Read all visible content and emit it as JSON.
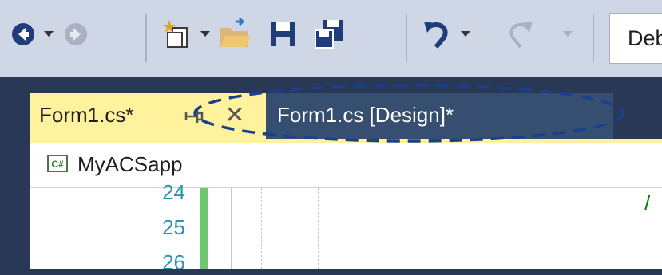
{
  "toolbar": {
    "icons": [
      "back-arrow-icon",
      "forward-arrow-icon",
      "new-project-icon",
      "open-file-icon",
      "save-icon",
      "save-all-icon",
      "undo-icon",
      "redo-icon",
      "chevron-down-icon"
    ],
    "solution_configuration": "Deb"
  },
  "tabs": [
    {
      "title": "Form1.cs*",
      "active": true,
      "pinned": false
    },
    {
      "title": "Form1.cs [Design]*",
      "active": false
    }
  ],
  "tab_close_glyph": "✕",
  "navigation_bar": {
    "language_badge": "C#",
    "project": "MyACSapp"
  },
  "editor": {
    "line_numbers": [
      "24",
      "25",
      "26"
    ],
    "code_fragment": "/"
  },
  "colors": {
    "active_tab": "#fff29d",
    "inactive_tab": "#364e6f",
    "frame": "#293955",
    "line_number": "#2b91af",
    "change_marker": "#6ec66e",
    "annotation": "#1a3f8f"
  }
}
